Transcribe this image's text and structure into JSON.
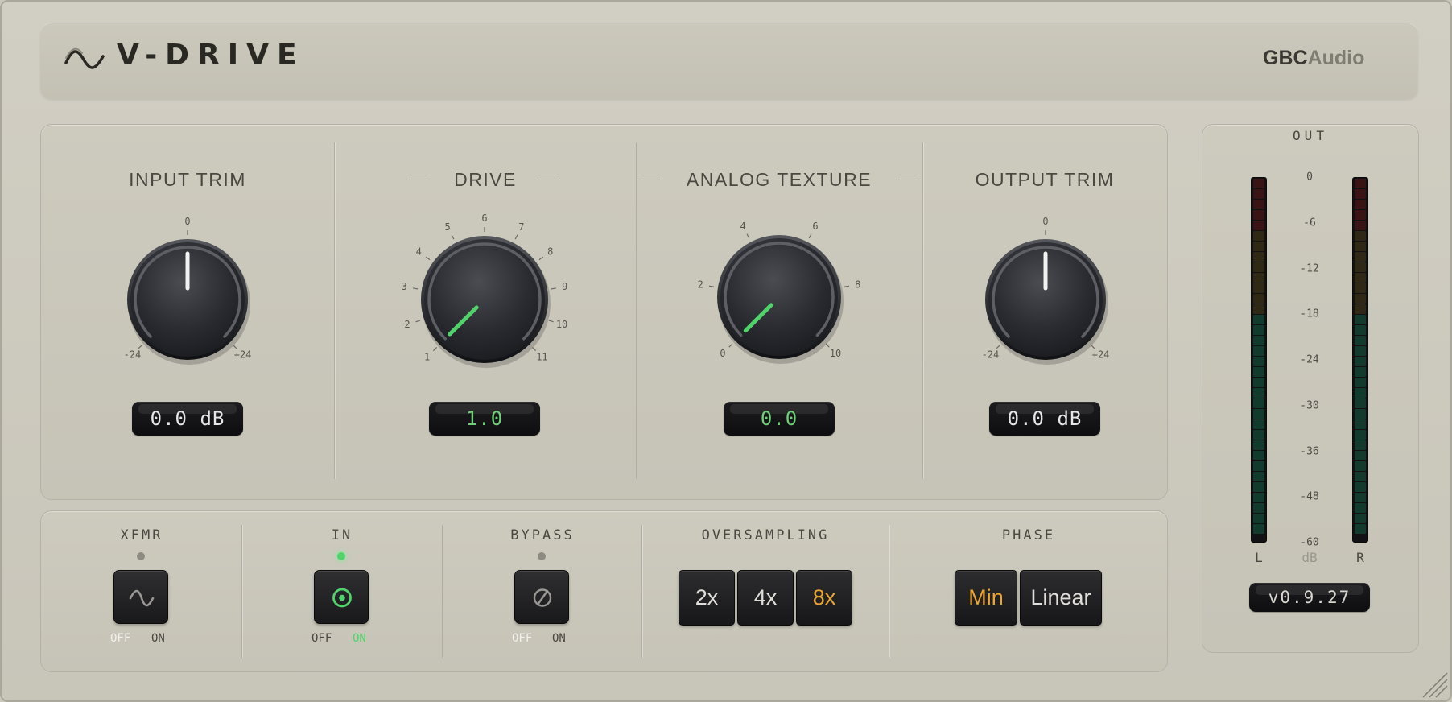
{
  "header": {
    "title": "V-DRIVE",
    "brand_bold": "GBC",
    "brand_light": "Audio",
    "logo_icon": "sine-wave-icon"
  },
  "knobs": [
    {
      "label": "INPUT TRIM",
      "display": "0.0 dB",
      "value": 0.0,
      "display_color": "#e6e6e6",
      "indicator_color": "#f2f2f2",
      "scale": {
        "top": "0",
        "min": "-24",
        "max": "+24"
      }
    },
    {
      "label": "DRIVE",
      "display": "1.0",
      "value": 1.0,
      "display_color": "#6fd07a",
      "indicator_color": "#4fd36a",
      "scale": [
        "1",
        "2",
        "3",
        "4",
        "5",
        "6",
        "7",
        "8",
        "9",
        "10",
        "11"
      ]
    },
    {
      "label": "ANALOG TEXTURE",
      "display": "0.0",
      "value": 0.0,
      "display_color": "#6fd07a",
      "indicator_color": "#4fd36a",
      "scale": [
        "0",
        "2",
        "4",
        "6",
        "8",
        "10"
      ]
    },
    {
      "label": "OUTPUT TRIM",
      "display": "0.0 dB",
      "value": 0.0,
      "display_color": "#e6e6e6",
      "indicator_color": "#f2f2f2",
      "scale": {
        "top": "0",
        "min": "-24",
        "max": "+24"
      }
    }
  ],
  "switches": [
    {
      "label": "XFMR",
      "icon": "sine-wave-icon",
      "state": "off",
      "off": "OFF",
      "on": "ON"
    },
    {
      "label": "IN",
      "icon": "power-target-icon",
      "state": "on",
      "off": "OFF",
      "on": "ON"
    },
    {
      "label": "BYPASS",
      "icon": "bypass-slash-icon",
      "state": "off",
      "off": "OFF",
      "on": "ON"
    }
  ],
  "oversampling": {
    "label": "OVERSAMPLING",
    "options": [
      "2x",
      "4x",
      "8x"
    ],
    "selected": "8x"
  },
  "phase": {
    "label": "PHASE",
    "options": [
      "Min",
      "Linear"
    ],
    "selected": "Min"
  },
  "meter": {
    "title": "OUT",
    "ticks": [
      "0",
      "-6",
      "-12",
      "-18",
      "-24",
      "-30",
      "-36",
      "-48",
      "-60"
    ],
    "left": "L",
    "right": "R",
    "unit": "dB",
    "version": "v0.9.27",
    "level_left": 0,
    "level_right": 0
  },
  "colors": {
    "accent_green": "#4fd36a",
    "accent_orange": "#e8a531",
    "off_label": "#f2f0ea",
    "on_label": "#4fd36a"
  }
}
